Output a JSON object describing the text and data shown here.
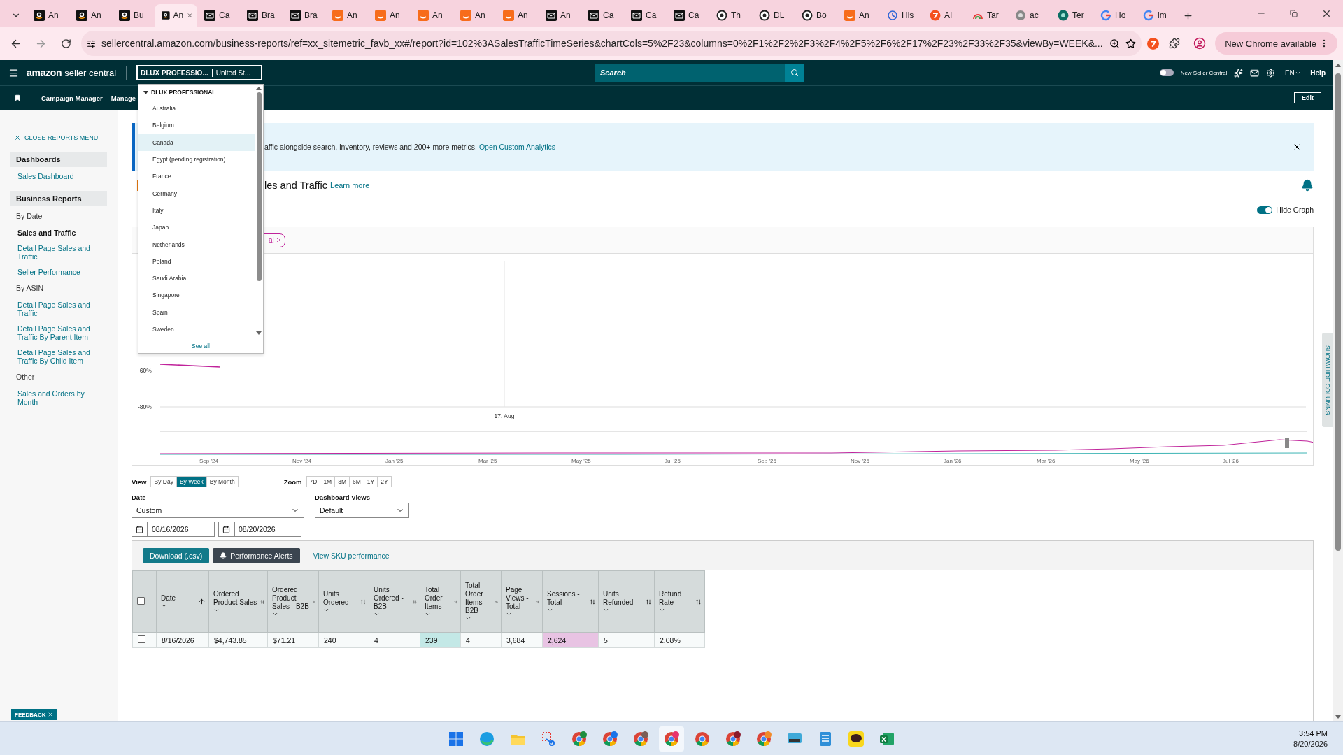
{
  "browser": {
    "tabs": [
      {
        "title": "An",
        "kind": "amazon",
        "selected": false
      },
      {
        "title": "An",
        "kind": "amazon",
        "selected": false
      },
      {
        "title": "Bu",
        "kind": "amazon",
        "selected": false
      },
      {
        "title": "An",
        "kind": "amazon",
        "selected": true
      },
      {
        "title": "Ca",
        "kind": "mail",
        "selected": false
      },
      {
        "title": "Bra",
        "kind": "mail",
        "selected": false
      },
      {
        "title": "Bra",
        "kind": "mail",
        "selected": false
      },
      {
        "title": "An",
        "kind": "orange",
        "selected": false
      },
      {
        "title": "An",
        "kind": "orange",
        "selected": false
      },
      {
        "title": "An",
        "kind": "orange",
        "selected": false
      },
      {
        "title": "An",
        "kind": "orange",
        "selected": false
      },
      {
        "title": "An",
        "kind": "orange",
        "selected": false
      },
      {
        "title": "An",
        "kind": "mail",
        "selected": false
      },
      {
        "title": "Ca",
        "kind": "mail",
        "selected": false
      },
      {
        "title": "Ca",
        "kind": "mail",
        "selected": false
      },
      {
        "title": "Ca",
        "kind": "mail",
        "selected": false
      },
      {
        "title": "Th",
        "kind": "ring",
        "selected": false
      },
      {
        "title": "DL",
        "kind": "ring",
        "selected": false
      },
      {
        "title": "Bo",
        "kind": "ring",
        "selected": false
      },
      {
        "title": "An",
        "kind": "orange",
        "selected": false
      },
      {
        "title": "His",
        "kind": "history",
        "selected": false
      },
      {
        "title": "AI",
        "kind": "badge",
        "selected": false
      },
      {
        "title": "Tar",
        "kind": "arc",
        "selected": false
      },
      {
        "title": "ac",
        "kind": "globe",
        "selected": false
      },
      {
        "title": "Ter",
        "kind": "teal",
        "selected": false
      },
      {
        "title": "Ho",
        "kind": "google",
        "selected": false
      },
      {
        "title": "im",
        "kind": "google",
        "selected": false
      }
    ],
    "url": "sellercentral.amazon.com/business-reports/ref=xx_sitemetric_favb_xx#/report?id=102%3ASalesTrafficTimeSeries&chartCols=5%2F23&columns=0%2F1%2F2%2F3%2F4%2F5%2F6%2F17%2F23%2F33%2F35&viewBy=WEEK&...",
    "update_label": "New Chrome available"
  },
  "header": {
    "brand": "amazon",
    "product": "seller central",
    "account": "DLUX PROFESSIO...",
    "marketplace": "United St...",
    "search_placeholder": "Search",
    "new_ui_label": "New Seller Central",
    "new_ui_on": false,
    "language": "EN",
    "help": "Help"
  },
  "subnav": {
    "items": [
      "Campaign Manager",
      "Manage"
    ],
    "edit": "Edit"
  },
  "account_menu": {
    "account": "DLUX PROFESSIONAL",
    "items": [
      {
        "label": "Australia",
        "selected": false
      },
      {
        "label": "Belgium",
        "selected": false
      },
      {
        "label": "Canada",
        "selected": true
      },
      {
        "label": "Egypt (pending registration)",
        "selected": false
      },
      {
        "label": "France",
        "selected": false
      },
      {
        "label": "Germany",
        "selected": false
      },
      {
        "label": "Italy",
        "selected": false
      },
      {
        "label": "Japan",
        "selected": false
      },
      {
        "label": "Netherlands",
        "selected": false
      },
      {
        "label": "Poland",
        "selected": false
      },
      {
        "label": "Saudi Arabia",
        "selected": false
      },
      {
        "label": "Singapore",
        "selected": false
      },
      {
        "label": "Spain",
        "selected": false
      },
      {
        "label": "Sweden",
        "selected": false
      }
    ],
    "footer": "See all"
  },
  "sidebar": {
    "close_label": "CLOSE REPORTS MENU",
    "sections": [
      {
        "title": "Dashboards",
        "items": [
          {
            "kind": "link",
            "label": "Sales Dashboard",
            "selected": false
          }
        ]
      },
      {
        "title": "Business Reports",
        "items": [
          {
            "kind": "group",
            "label": "By Date"
          },
          {
            "kind": "link",
            "label": "Sales and Traffic",
            "selected": true
          },
          {
            "kind": "link",
            "label": "Detail Page Sales and Traffic",
            "selected": false
          },
          {
            "kind": "link",
            "label": "Seller Performance",
            "selected": false
          },
          {
            "kind": "group",
            "label": "By ASIN"
          },
          {
            "kind": "link",
            "label": "Detail Page Sales and Traffic",
            "selected": false
          },
          {
            "kind": "link",
            "label": "Detail Page Sales and Traffic By Parent Item",
            "selected": false
          },
          {
            "kind": "link",
            "label": "Detail Page Sales and Traffic By Child Item",
            "selected": false
          },
          {
            "kind": "group",
            "label": "Other"
          },
          {
            "kind": "link",
            "label": "Sales and Orders by Month",
            "selected": false
          }
        ]
      }
    ],
    "feedback": "FEEDBACK"
  },
  "banner": {
    "text": "affic alongside search, inventory, reviews and 200+ more metrics.",
    "link": "Open Custom Analytics"
  },
  "report": {
    "title": "les and Traffic",
    "learn_more": "Learn more",
    "hide_graph_label": "Hide Graph",
    "hide_graph_on": true,
    "side_tab": "SHOW/HIDE COLUMNS"
  },
  "chart": {
    "chips": [
      {
        "label": "al",
        "color": "#c0239b"
      }
    ],
    "plot": {
      "y_labels": [
        "-60%",
        "-80%"
      ],
      "x_label": "17. Aug"
    },
    "navigator_labels": [
      "Sep '24",
      "Nov '24",
      "Jan '25",
      "Mar '25",
      "May '25",
      "Jul '25",
      "Sep '25",
      "Nov '25",
      "Jan '26",
      "Mar '26",
      "May '26",
      "Jul '26"
    ]
  },
  "controls": {
    "view_label": "View",
    "views": [
      {
        "label": "By Day",
        "selected": false
      },
      {
        "label": "By Week",
        "selected": true
      },
      {
        "label": "By Month",
        "selected": false
      }
    ],
    "zoom_label": "Zoom",
    "zooms": [
      "7D",
      "1M",
      "3M",
      "6M",
      "1Y",
      "2Y"
    ],
    "date_label": "Date",
    "date_value": "Custom",
    "views_label": "Dashboard Views",
    "views_value": "Default",
    "start_date": "08/16/2026",
    "end_date": "08/20/2026"
  },
  "actions": {
    "download": "Download (.csv)",
    "alerts": "Performance Alerts",
    "sku_link": "View SKU performance"
  },
  "table": {
    "header_checked": false,
    "columns": [
      {
        "label": "Date",
        "sorted": true
      },
      {
        "label": "Ordered Product Sales",
        "sorted": false
      },
      {
        "label": "Ordered Product Sales - B2B",
        "sorted": false
      },
      {
        "label": "Units Ordered",
        "sorted": false
      },
      {
        "label": "Units Ordered - B2B",
        "sorted": false
      },
      {
        "label": "Total Order Items",
        "sorted": false
      },
      {
        "label": "Total Order Items - B2B",
        "sorted": false
      },
      {
        "label": "Page Views - Total",
        "sorted": false
      },
      {
        "label": "Sessions - Total",
        "sorted": false
      },
      {
        "label": "Units Refunded",
        "sorted": false
      },
      {
        "label": "Refund Rate",
        "sorted": false
      }
    ],
    "rows": [
      {
        "checked": false,
        "cells": [
          {
            "text": "8/16/2026"
          },
          {
            "text": "$4,743.85"
          },
          {
            "text": "$71.21"
          },
          {
            "text": "240"
          },
          {
            "text": "4"
          },
          {
            "text": "239",
            "color": "#c3e8e6"
          },
          {
            "text": "4"
          },
          {
            "text": "3,684"
          },
          {
            "text": "2,624",
            "color": "#e8c3e3"
          },
          {
            "text": "5"
          },
          {
            "text": "2.08%"
          }
        ]
      }
    ]
  },
  "taskbar": {
    "apps": [
      {
        "kind": "start",
        "selected": false
      },
      {
        "kind": "edge",
        "selected": false
      },
      {
        "kind": "folder",
        "selected": false
      },
      {
        "kind": "snip",
        "selected": false
      },
      {
        "kind": "chrome",
        "color": "#1e8e3e",
        "selected": false
      },
      {
        "kind": "chrome",
        "color": "#1a73e8",
        "selected": false
      },
      {
        "kind": "chrome",
        "color": "#7b5e57",
        "selected": false
      },
      {
        "kind": "chrome",
        "color": "#e8336d",
        "selected": true
      },
      {
        "kind": "chrome",
        "selected": false
      },
      {
        "kind": "chrome",
        "color": "#8b1a2b",
        "selected": false
      },
      {
        "kind": "chrome",
        "color": "#f28b2a",
        "selected": false
      },
      {
        "kind": "keyboard",
        "selected": false
      },
      {
        "kind": "notepad",
        "selected": false
      },
      {
        "kind": "chat",
        "selected": false
      },
      {
        "kind": "excel",
        "selected": false
      }
    ],
    "time": "3:54 PM",
    "date": "8/20/2026"
  }
}
